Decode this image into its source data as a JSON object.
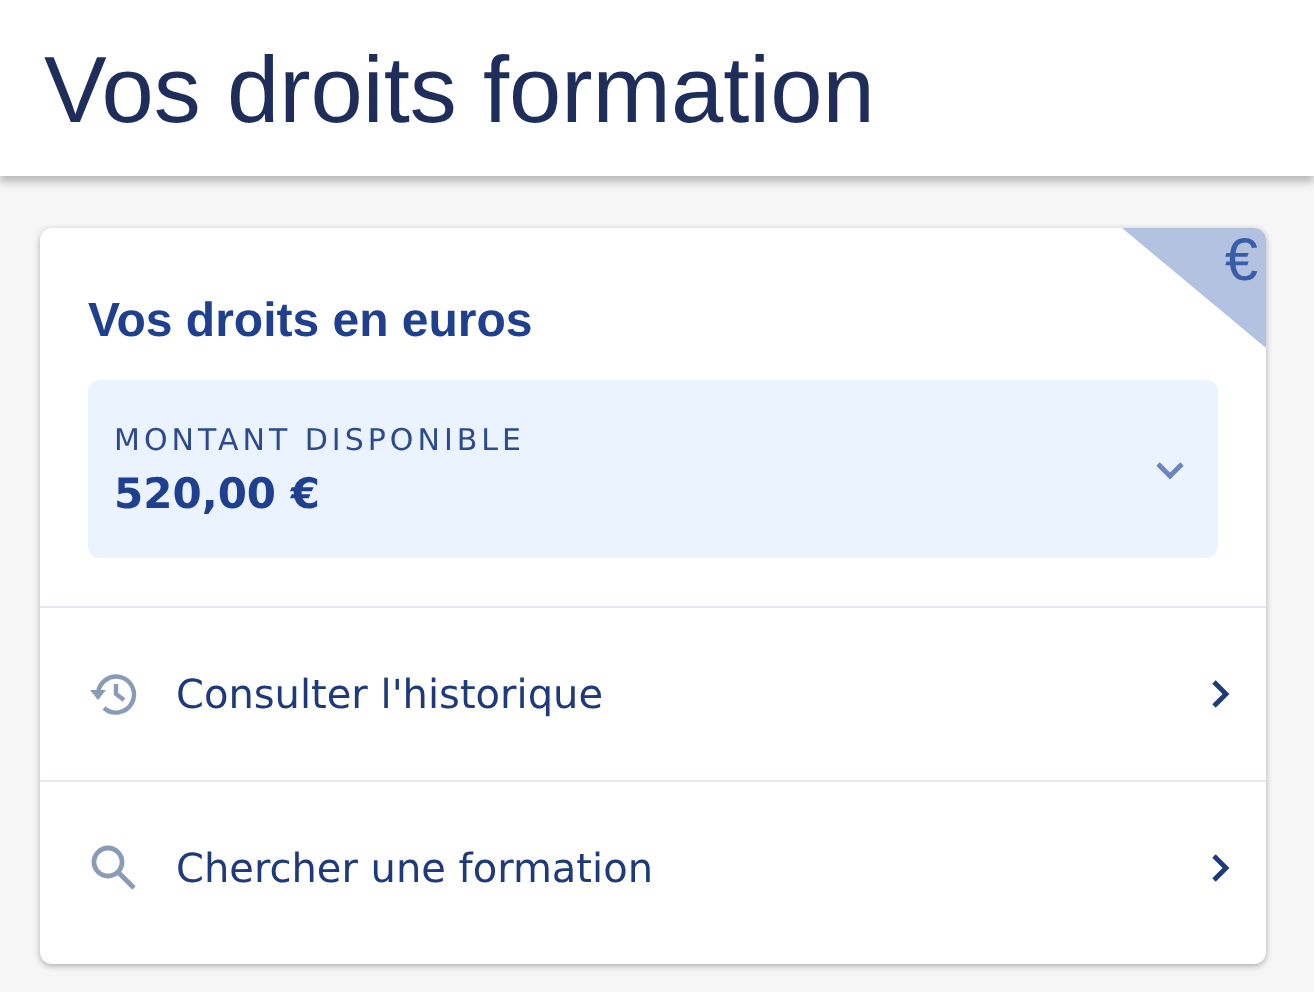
{
  "page_title": "Vos droits formation",
  "card": {
    "corner_badge": "€",
    "title": "Vos droits en euros",
    "amount_panel": {
      "label": "MONTANT DISPONIBLE",
      "value": "520,00 €",
      "expanded": false
    },
    "links": [
      {
        "kind": "history",
        "label": "Consulter l'historique"
      },
      {
        "kind": "search",
        "label": "Chercher une formation"
      }
    ]
  }
}
